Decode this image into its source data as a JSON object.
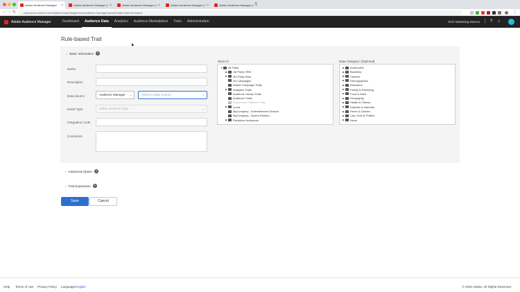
{
  "browser": {
    "tabs": [
      {
        "label": "Adobe Audience Manager",
        "active": true
      },
      {
        "label": "Adobe Audience Manager | D...",
        "active": false
      },
      {
        "label": "Adobe Audience Manager | D...",
        "active": false
      },
      {
        "label": "Adobe Audience Manager | D...",
        "active": false
      },
      {
        "label": "Adobe Audience Manager | D...",
        "active": false
      }
    ],
    "url": "experience.adobe.com/#/@techmarketingdemos/audience-manager/portal/Traits-Add/rule-based"
  },
  "app": {
    "name": "Adobe Audience Manager",
    "nav": [
      {
        "label": "Dashboard",
        "active": false
      },
      {
        "label": "Audience Data",
        "active": true
      },
      {
        "label": "Analytics",
        "active": false
      },
      {
        "label": "Audience Marketplace",
        "active": false
      },
      {
        "label": "Tools",
        "active": false
      },
      {
        "label": "Administration",
        "active": false
      }
    ],
    "org": "Tech Marketing Demos"
  },
  "page": {
    "title": "Rule-based Trait",
    "basic_section": "Basic Information",
    "advanced_section": "Advanced Option",
    "expression_section": "Trait Expression",
    "help_glyph": "?"
  },
  "form": {
    "name_label": "Name",
    "description_label": "Description",
    "datasource_label": "Data Source",
    "datasource_type": "Audience Manager",
    "datasource_placeholder": "Select a Data Source",
    "eventtype_label": "Event Type",
    "eventtype_placeholder": "Select an Event Type",
    "integration_label": "Integration Code",
    "comments_label": "Comments"
  },
  "store_in": {
    "label": "Store in:",
    "items": [
      {
        "label": "All Traits",
        "level": 0,
        "arrow": "▼",
        "dim": false
      },
      {
        "label": "1st Party CRM",
        "level": 1,
        "arrow": "▶",
        "dim": false
      },
      {
        "label": "3rd Party Data",
        "level": 1,
        "arrow": "▶",
        "dim": false
      },
      {
        "label": "Ad Campaigns",
        "level": 1,
        "arrow": "",
        "dim": false
      },
      {
        "label": "Adobe Campaign Traits",
        "level": 1,
        "arrow": "",
        "dim": false
      },
      {
        "label": "Analytics Traits",
        "level": 1,
        "arrow": "▶",
        "dim": false
      },
      {
        "label": "Audience Library Traits",
        "level": 1,
        "arrow": "",
        "dim": false
      },
      {
        "label": "Audience Traits",
        "level": 1,
        "arrow": "",
        "dim": false
      },
      {
        "label": "Experience Platform Traits",
        "level": 1,
        "arrow": "",
        "dim": true
      },
      {
        "label": "Luma",
        "level": 1,
        "arrow": "▶",
        "dim": false
      },
      {
        "label": "MyCompany - Entertainment Division",
        "level": 1,
        "arrow": "",
        "dim": false
      },
      {
        "label": "MyCompany - Sports Division",
        "level": 1,
        "arrow": "",
        "dim": false
      },
      {
        "label": "Predictive Audiences",
        "level": 1,
        "arrow": "▶",
        "dim": false
      }
    ]
  },
  "data_category": {
    "label": "Data Category:",
    "optional": "(Optional)",
    "items": [
      {
        "label": "Automotive",
        "arrow": "▶"
      },
      {
        "label": "Business",
        "arrow": "▶"
      },
      {
        "label": "Careers",
        "arrow": "▶"
      },
      {
        "label": "Demographics",
        "arrow": "▶"
      },
      {
        "label": "Education",
        "arrow": "▶"
      },
      {
        "label": "Family & Parenting",
        "arrow": "▶"
      },
      {
        "label": "Food & Drink",
        "arrow": "▶"
      },
      {
        "label": "Geography",
        "arrow": "▶"
      },
      {
        "label": "Health & Fitness",
        "arrow": "▶"
      },
      {
        "label": "Hobbies & Interests",
        "arrow": "▶"
      },
      {
        "label": "Home & Garden",
        "arrow": "▶"
      },
      {
        "label": "Law, Govt & Politics",
        "arrow": "▶"
      },
      {
        "label": "News",
        "arrow": "▶"
      }
    ]
  },
  "actions": {
    "save": "Save",
    "cancel": "Cancel"
  },
  "footer": {
    "help": "Help",
    "terms": "Terms of Use",
    "privacy": "Privacy Policy",
    "language_label": "Language:",
    "language_value": "English",
    "copyright": "© 2020 Adobe. All Rights Reserved."
  }
}
